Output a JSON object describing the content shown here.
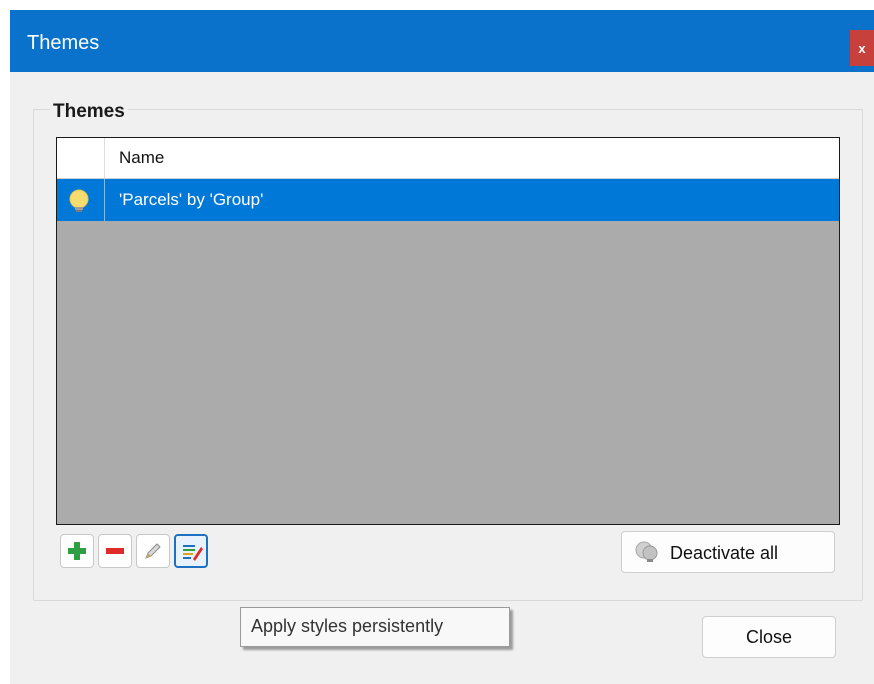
{
  "window": {
    "title": "Themes",
    "close_glyph": "x"
  },
  "group": {
    "legend": "Themes"
  },
  "grid": {
    "columns": [
      "",
      "Name"
    ],
    "rows": [
      {
        "icon": "lightbulb-on-icon",
        "name": "'Parcels' by 'Group'",
        "selected": true
      }
    ]
  },
  "toolbar": {
    "buttons": [
      {
        "icon": "plus-icon",
        "color": "#2ea043"
      },
      {
        "icon": "minus-icon",
        "color": "#e02b2b"
      },
      {
        "icon": "pencil-icon",
        "color": "#9a9a9a"
      },
      {
        "icon": "apply-styles-icon",
        "color": "#1e70c0"
      }
    ],
    "deactivate_label": "Deactivate all"
  },
  "tooltip": {
    "text": "Apply styles persistently"
  },
  "footer": {
    "close_label": "Close"
  },
  "colors": {
    "titlebar": "#0b72cc",
    "selection": "#0078d7",
    "grid_background": "#ababab"
  }
}
